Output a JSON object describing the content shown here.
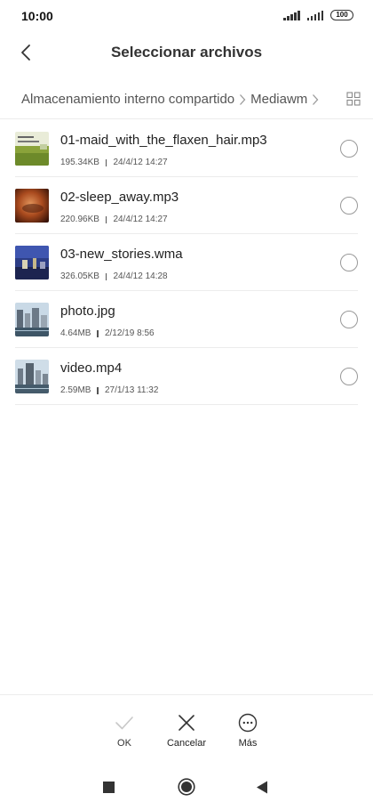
{
  "status_bar": {
    "time": "10:00",
    "battery": "100"
  },
  "header": {
    "title": "Seleccionar archivos",
    "back_icon": "chevron-left-icon"
  },
  "breadcrumb": {
    "items": [
      "Almacenamiento interno compartido",
      "Mediawm"
    ],
    "view_toggle_icon": "grid-view-icon"
  },
  "files": [
    {
      "name": "01-maid_with_the_flaxen_hair.mp3",
      "size": "195.34KB",
      "date": "24/4/12 14:27",
      "thumb": "album-art-green",
      "selected": false
    },
    {
      "name": "02-sleep_away.mp3",
      "size": "220.96KB",
      "date": "24/4/12 14:27",
      "thumb": "album-art-orange",
      "selected": false
    },
    {
      "name": "03-new_stories.wma",
      "size": "326.05KB",
      "date": "24/4/12 14:28",
      "thumb": "album-art-blue",
      "selected": false
    },
    {
      "name": "photo.jpg",
      "size": "4.64MB",
      "date": "2/12/19 8:56",
      "thumb": "city-photo",
      "selected": false
    },
    {
      "name": "video.mp4",
      "size": "2.59MB",
      "date": "27/1/13 11:32",
      "thumb": "city-video",
      "selected": false
    }
  ],
  "actions": {
    "ok": "OK",
    "cancel": "Cancelar",
    "more": "Más"
  },
  "colors": {
    "background": "#ffffff",
    "divider": "#ececec",
    "text_primary": "#222222",
    "text_secondary": "#555555",
    "disabled_icon": "#c8c8c8"
  }
}
